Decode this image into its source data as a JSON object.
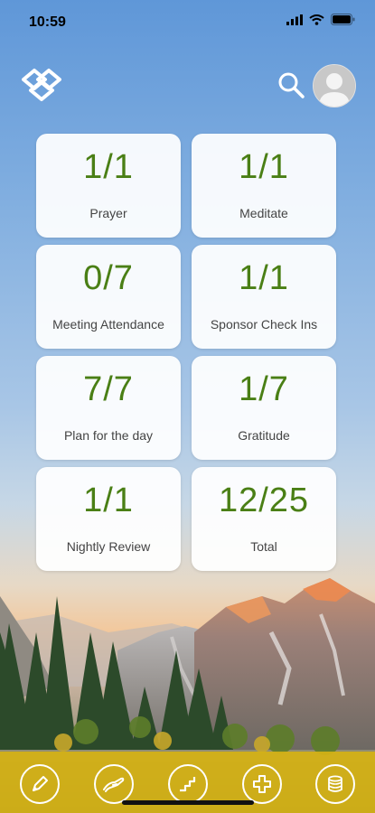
{
  "status": {
    "time": "10:59"
  },
  "icons": {
    "logo": "app-logo-icon",
    "search": "search-icon",
    "avatar": "avatar-icon",
    "tabs": [
      "pencil-icon",
      "helping-hand-icon",
      "steps-icon",
      "plus-icon",
      "coins-icon"
    ]
  },
  "colors": {
    "value_green": "#4a7f15",
    "tab_bar": "#d6b214"
  },
  "tiles": [
    {
      "value": "1/1",
      "label": "Prayer"
    },
    {
      "value": "1/1",
      "label": "Meditate"
    },
    {
      "value": "0/7",
      "label": "Meeting Attendance"
    },
    {
      "value": "1/1",
      "label": "Sponsor Check Ins"
    },
    {
      "value": "7/7",
      "label": "Plan for the day"
    },
    {
      "value": "1/7",
      "label": "Gratitude"
    },
    {
      "value": "1/1",
      "label": "Nightly Review"
    },
    {
      "value": "12/25",
      "label": "Total"
    }
  ]
}
